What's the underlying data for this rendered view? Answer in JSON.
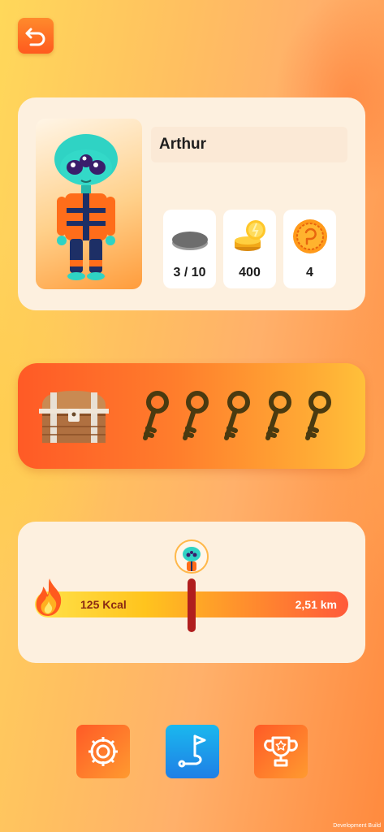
{
  "profile": {
    "name": "Arthur",
    "stats": [
      {
        "icon": "stone-icon",
        "value": "3 / 10"
      },
      {
        "icon": "coins-icon",
        "value": "400"
      },
      {
        "icon": "medal-coin-icon",
        "value": "4"
      }
    ]
  },
  "keys": {
    "count": 5
  },
  "distance": {
    "kcal": "125 Kcal",
    "km": "2,51 km",
    "progress": 0.5
  },
  "nav": [
    "settings-icon",
    "route-flag-icon",
    "trophy-icon"
  ],
  "footer": {
    "dev_build": "Development Build"
  },
  "colors": {
    "accent": "#ff6a26",
    "key": "#4a3a10",
    "marker": "#b01e1e",
    "route_button": "#1f9ae8"
  }
}
